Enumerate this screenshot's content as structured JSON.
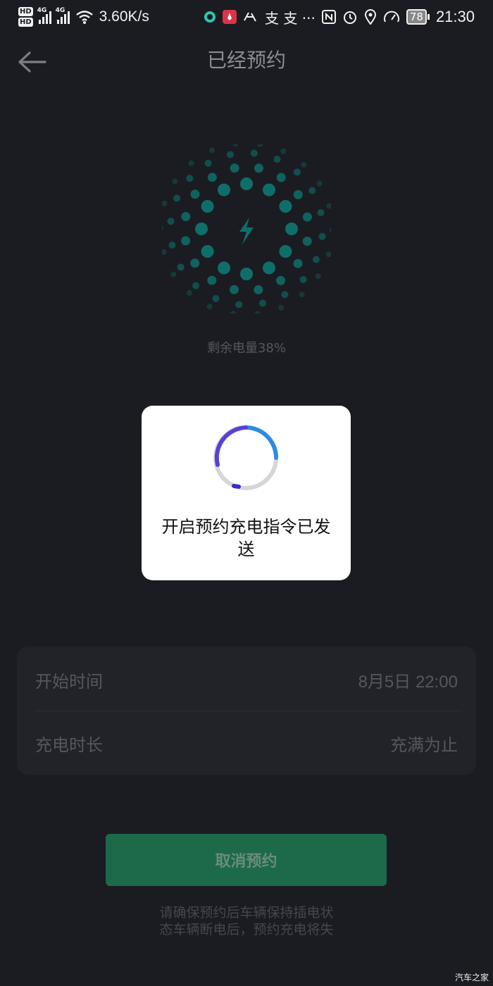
{
  "status_bar": {
    "hd1": "HD",
    "hd2": "HD",
    "net1": "4G",
    "net2": "4G",
    "speed": "3.60K/s",
    "apps": "支 支 ···",
    "battery": "78",
    "time": "21:30"
  },
  "header": {
    "title": "已经预约"
  },
  "charge": {
    "remaining_label": "剩余电量38%"
  },
  "toast": {
    "message": "开启预约充电指令已发送"
  },
  "schedule": {
    "rows": [
      {
        "label": "开始时间",
        "value": "8月5日 22:00"
      },
      {
        "label": "充电时长",
        "value": "充满为止"
      }
    ]
  },
  "actions": {
    "cancel_label": "取消预约"
  },
  "notice": {
    "line1": "请确保预约后车辆保持插电状",
    "line2": "态车辆断电后，预约充电将失"
  },
  "watermark": "汽车之家",
  "colors": {
    "background": "#1b1c21",
    "accent_green": "#1c6a49",
    "orb_teal": "#0e6f6a",
    "spinner_blue": "#2d8be0",
    "spinner_purple": "#5a3fd8"
  }
}
